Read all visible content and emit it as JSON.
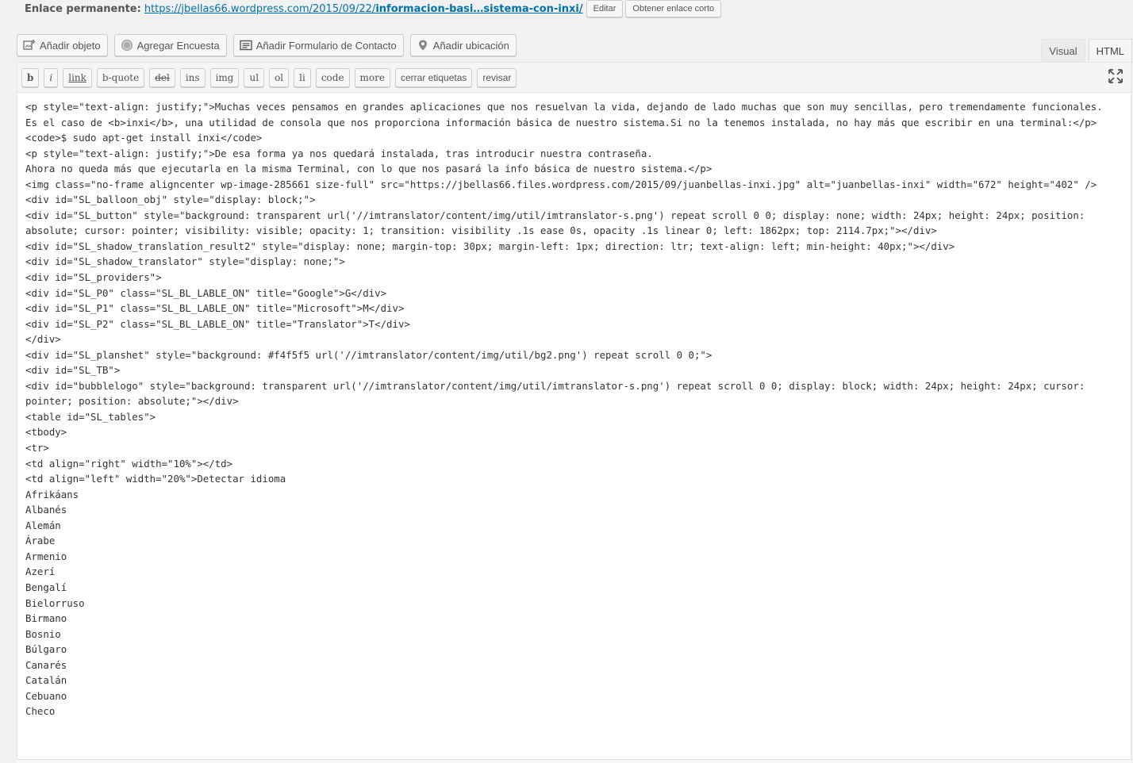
{
  "permalink": {
    "label": "Enlace permanente:",
    "url_prefix": "https://jbellas66.wordpress.com/2015/09/22/",
    "url_slug": "informacion-basi…sistema-con-inxi/",
    "edit_label": "Editar",
    "shortlink_label": "Obtener enlace corto"
  },
  "media_buttons": [
    {
      "label": "Añadir objeto",
      "icon": "add-media-icon"
    },
    {
      "label": "Agregar Encuesta",
      "icon": "poll-icon"
    },
    {
      "label": "Añadir Formulario de Contacto",
      "icon": "contact-form-icon"
    },
    {
      "label": "Añadir ubicación",
      "icon": "location-pin-icon"
    }
  ],
  "editor_tabs": {
    "visual": "Visual",
    "html": "HTML",
    "active": "html"
  },
  "quicktags": [
    "b",
    "i",
    "link",
    "b-quote",
    "del",
    "ins",
    "img",
    "ul",
    "ol",
    "li",
    "code",
    "more",
    "cerrar etiquetas",
    "revisar"
  ],
  "editor": {
    "content": "<p style=\"text-align: justify;\">Muchas veces pensamos en grandes aplicaciones que nos resuelvan la vida, dejando de lado muchas que son muy sencillas, pero tremendamente funcionales.\nEs el caso de <b>inxi</b>, una utilidad de consola que nos proporciona información básica de nuestro sistema.Si no la tenemos instalada, no hay más que escribir en una terminal:</p>\n<code>$ sudo apt-get install inxi</code>\n<p style=\"text-align: justify;\">De esa forma ya nos quedará instalada, tras introducir nuestra contraseña.\nAhora no queda más que ejecutarla en la misma Terminal, con lo que nos pasará la info básica de nuestro sistema.</p>\n<img class=\"no-frame aligncenter wp-image-285661 size-full\" src=\"https://jbellas66.files.wordpress.com/2015/09/juanbellas-inxi.jpg\" alt=\"juanbellas-inxi\" width=\"672\" height=\"402\" />\n<div id=\"SL_balloon_obj\" style=\"display: block;\">\n<div id=\"SL_button\" style=\"background: transparent url('//imtranslator/content/img/util/imtranslator-s.png') repeat scroll 0 0; display: none; width: 24px; height: 24px; position: absolute; cursor: pointer; visibility: visible; opacity: 1; transition: visibility .1s ease 0s, opacity .1s linear 0; left: 1862px; top: 2114.7px;\"></div>\n<div id=\"SL_shadow_translation_result2\" style=\"display: none; margin-top: 30px; margin-left: 1px; direction: ltr; text-align: left; min-height: 40px;\"></div>\n<div id=\"SL_shadow_translator\" style=\"display: none;\">\n<div id=\"SL_providers\">\n<div id=\"SL_P0\" class=\"SL_BL_LABLE_ON\" title=\"Google\">G</div>\n<div id=\"SL_P1\" class=\"SL_BL_LABLE_ON\" title=\"Microsoft\">M</div>\n<div id=\"SL_P2\" class=\"SL_BL_LABLE_ON\" title=\"Translator\">T</div>\n</div>\n<div id=\"SL_planshet\" style=\"background: #f4f5f5 url('//imtranslator/content/img/util/bg2.png') repeat scroll 0 0;\">\n<div id=\"SL_TB\">\n<div id=\"bubblelogo\" style=\"background: transparent url('//imtranslator/content/img/util/imtranslator-s.png') repeat scroll 0 0; display: block; width: 24px; height: 24px; cursor: pointer; position: absolute;\"></div>\n<table id=\"SL_tables\">\n<tbody>\n<tr>\n<td align=\"right\" width=\"10%\"></td>\n<td align=\"left\" width=\"20%\">Detectar idioma\nAfrikáans\nAlbanés\nAlemán\nÁrabe\nArmenio\nAzerí\nBengalí\nBielorruso\nBirmano\nBosnio\nBúlgaro\nCanarés\nCatalán\nCebuano\nCheco"
  }
}
